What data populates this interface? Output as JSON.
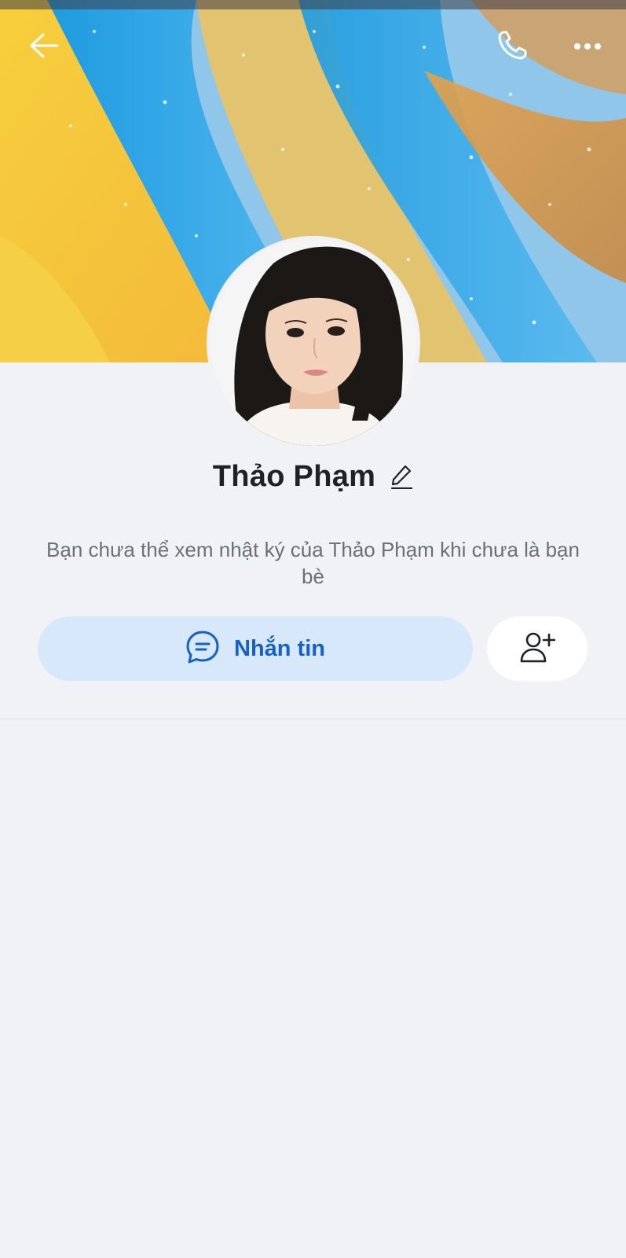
{
  "profile": {
    "name": "Thảo Phạm",
    "notice": "Bạn chưa thể xem nhật ký của Thảo Phạm khi chưa là bạn bè"
  },
  "actions": {
    "message_label": "Nhắn tin"
  },
  "icons": {
    "back": "arrow-left-icon",
    "call": "phone-icon",
    "more": "more-horizontal-icon",
    "edit": "pencil-icon",
    "message": "chat-bubble-icon",
    "add_friend": "add-user-icon"
  },
  "colors": {
    "accent": "#1560c9",
    "message_button_bg": "#d8e8fb",
    "page_bg": "#f0f2f6"
  }
}
